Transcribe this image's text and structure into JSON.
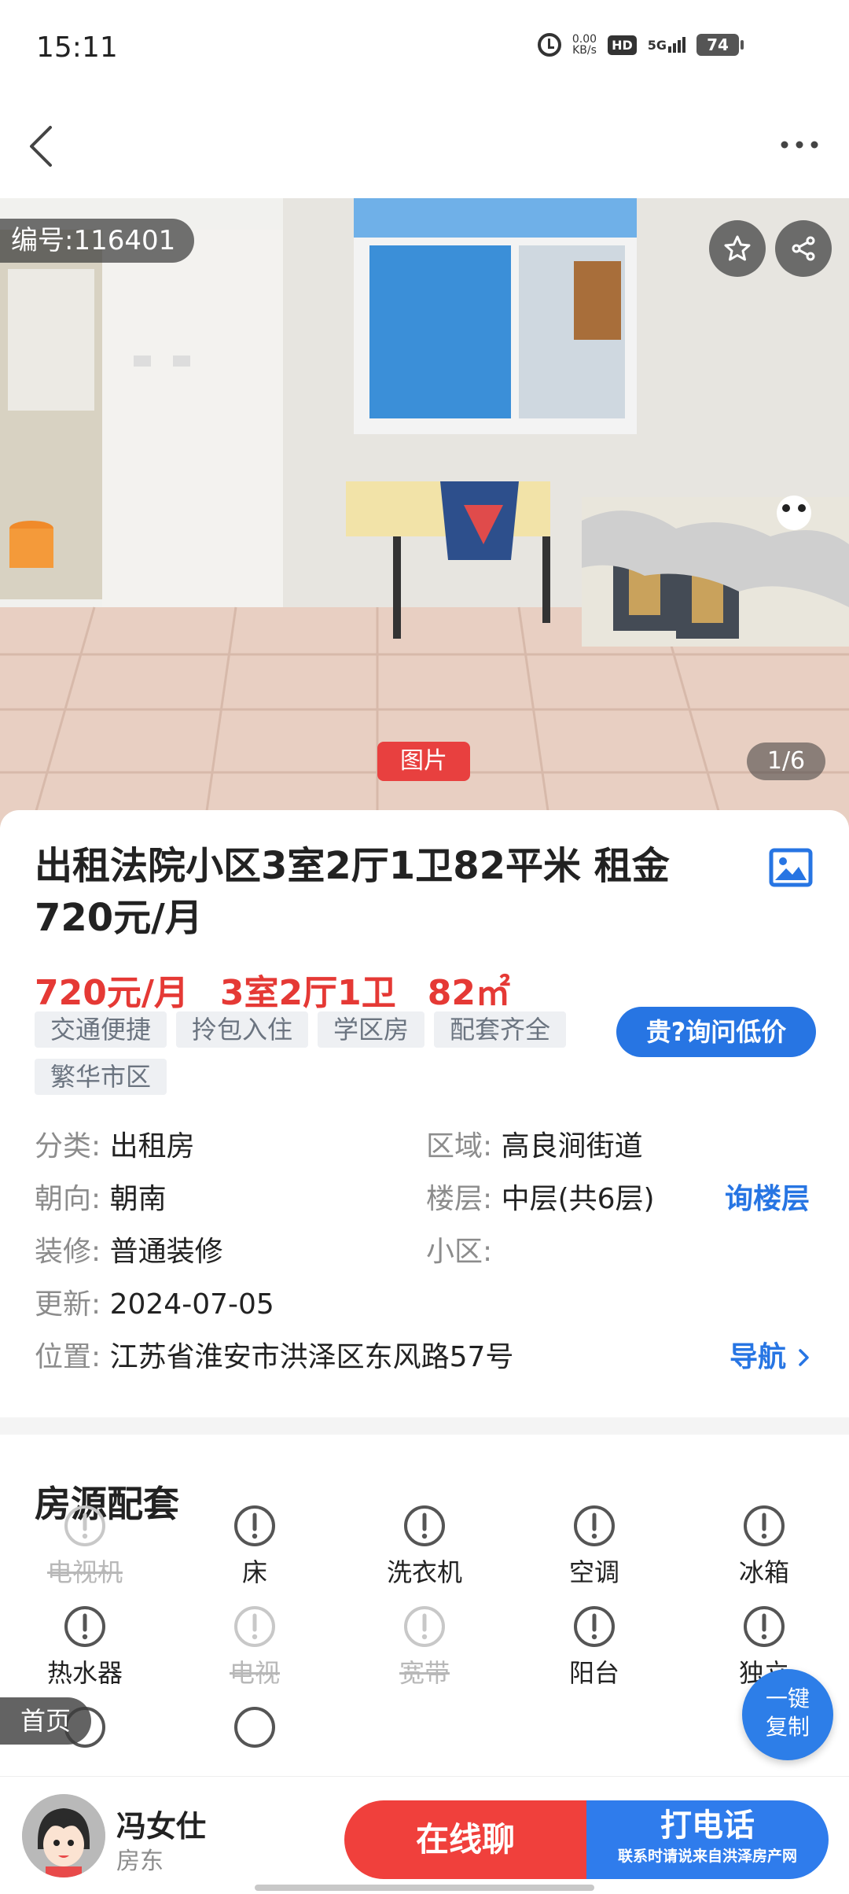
{
  "status_bar": {
    "time": "15:11",
    "net_speed_value": "0.00",
    "net_speed_unit": "KB/s",
    "hd": "HD",
    "network": "5G",
    "battery": "74"
  },
  "photo": {
    "listing_id": "编号:116401",
    "image_tag": "图片",
    "image_count": "1/6"
  },
  "listing": {
    "title": "出租法院小区3室2厅1卫82平米 租金720元/月",
    "price": "720元/月",
    "layout": "3室2厅1卫",
    "area": "82㎡",
    "tags": [
      "交通便捷",
      "拎包入住",
      "学区房",
      "配套齐全",
      "繁华市区"
    ],
    "ask_price_button": "贵?询问低价",
    "fields": {
      "category": {
        "label": "分类:",
        "value": "出租房"
      },
      "region": {
        "label": "区域:",
        "value": "高良涧街道"
      },
      "orientation": {
        "label": "朝向:",
        "value": "朝南"
      },
      "floor": {
        "label": "楼层:",
        "value": "中层(共6层)"
      },
      "ask_floor": "询楼层",
      "decoration": {
        "label": "装修:",
        "value": "普通装修"
      },
      "community": {
        "label": "小区:",
        "value": ""
      },
      "updated": {
        "label": "更新:",
        "value": "2024-07-05"
      },
      "location": {
        "label": "位置:",
        "value": "江苏省淮安市洪泽区东风路57号"
      },
      "navigate": "导航"
    }
  },
  "facilities": {
    "title": "房源配套",
    "items": [
      {
        "label": "电视机",
        "available": false
      },
      {
        "label": "床",
        "available": true
      },
      {
        "label": "洗衣机",
        "available": true
      },
      {
        "label": "空调",
        "available": true
      },
      {
        "label": "冰箱",
        "available": true
      },
      {
        "label": "热水器",
        "available": true
      },
      {
        "label": "电视",
        "available": false
      },
      {
        "label": "宽带",
        "available": false
      },
      {
        "label": "阳台",
        "available": true
      },
      {
        "label": "独立",
        "available": true
      }
    ]
  },
  "floating": {
    "home": "首页",
    "copy_line1": "一键",
    "copy_line2": "复制"
  },
  "owner": {
    "name": "冯女仕",
    "role": "房东"
  },
  "actions": {
    "chat": "在线聊",
    "call": "打电话",
    "call_note": "联系时请说来自洪泽房产网"
  },
  "colors": {
    "price_red": "#e53935",
    "accent_blue": "#2775e3",
    "chat_red": "#f0403c",
    "call_blue": "#2f7cec"
  }
}
